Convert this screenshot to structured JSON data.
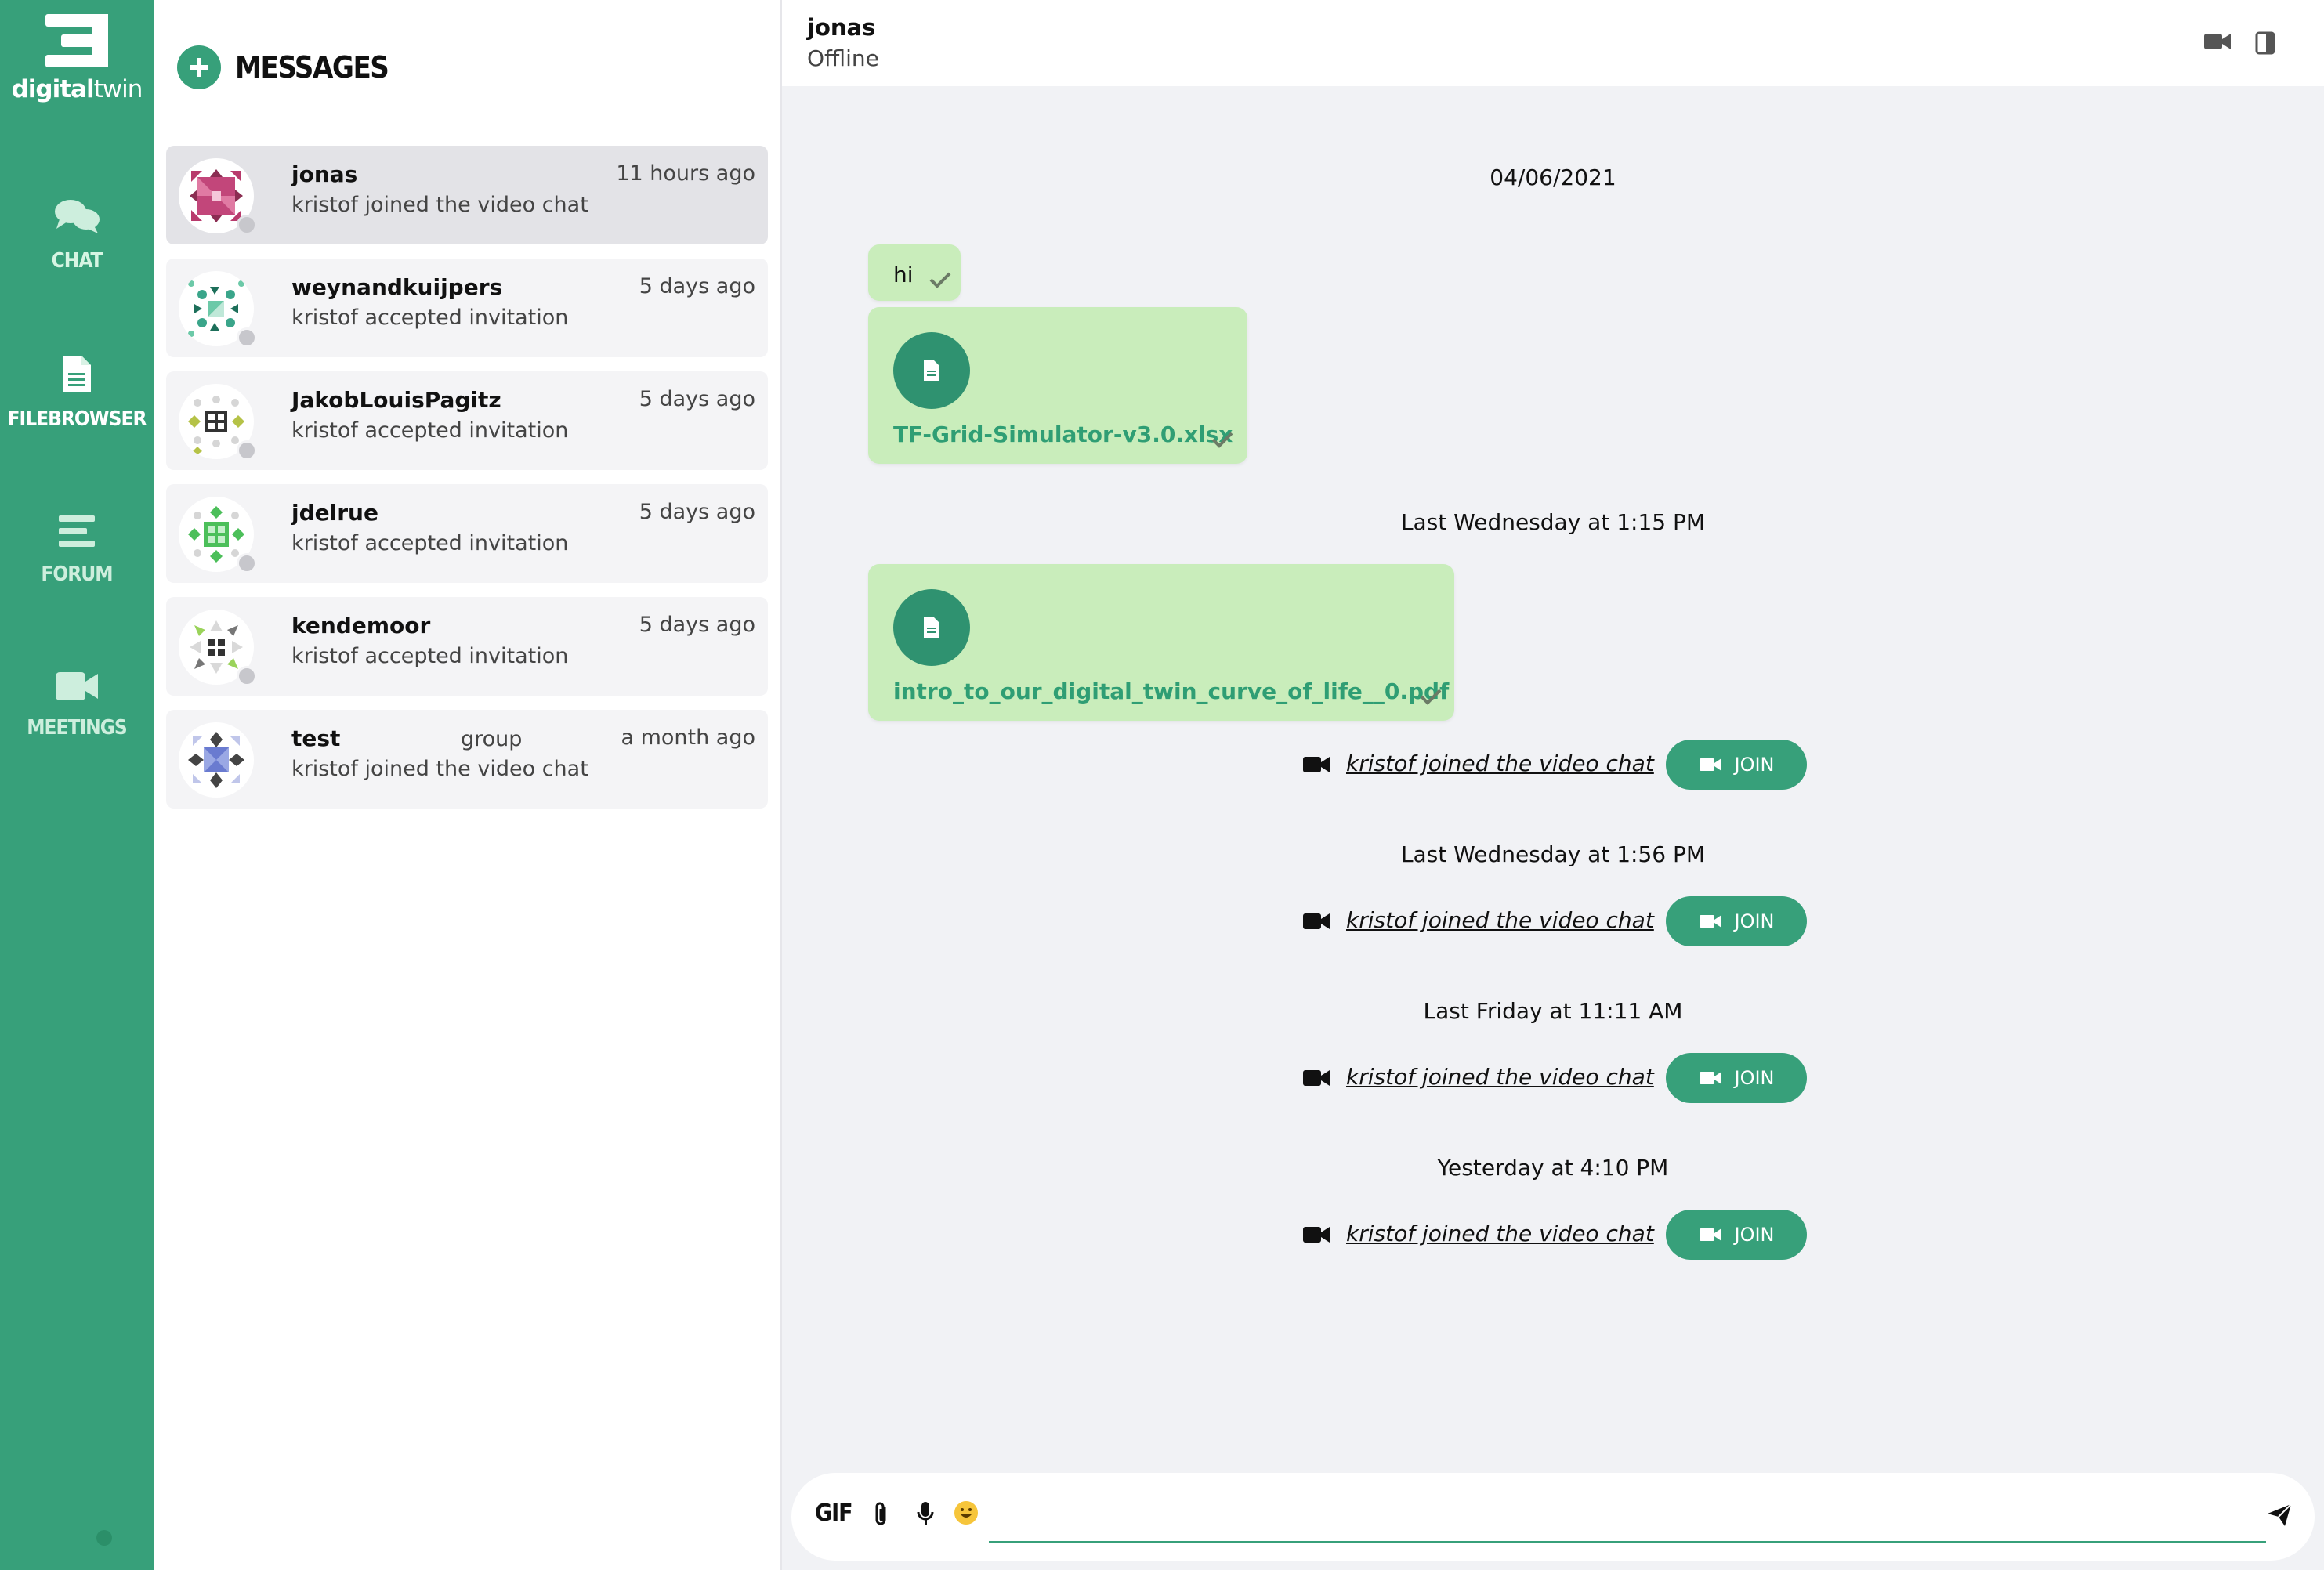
{
  "brand": {
    "logo_bold": "digital",
    "logo_light": "twin"
  },
  "nav": {
    "items": [
      {
        "label": "CHAT",
        "icon": "chat-bubbles-icon"
      },
      {
        "label": "FILEBROWSER",
        "icon": "file-icon"
      },
      {
        "label": "FORUM",
        "icon": "forum-lines-icon"
      },
      {
        "label": "MEETINGS",
        "icon": "video-camera-icon"
      }
    ],
    "accent": "#37a07a"
  },
  "list": {
    "title": "MESSAGES",
    "conversations": [
      {
        "name": "jonas",
        "tag": "",
        "time": "11 hours ago",
        "last": "kristof joined the video chat",
        "selected": true
      },
      {
        "name": "weynandkuijpers",
        "tag": "",
        "time": "5 days ago",
        "last": "kristof accepted invitation"
      },
      {
        "name": "JakobLouisPagitz",
        "tag": "",
        "time": "5 days ago",
        "last": "kristof accepted invitation"
      },
      {
        "name": "jdelrue",
        "tag": "",
        "time": "5 days ago",
        "last": "kristof accepted invitation"
      },
      {
        "name": "kendemoor",
        "tag": "",
        "time": "5 days ago",
        "last": "kristof accepted invitation"
      },
      {
        "name": "test",
        "tag": "group",
        "time": "a month ago",
        "last": "kristof joined the video chat"
      }
    ]
  },
  "chat": {
    "name": "jonas",
    "status": "Offline",
    "separators": [
      "04/06/2021",
      "Last Wednesday at 1:15 PM",
      "Last Wednesday at 1:56 PM",
      "Last Friday at 11:11 AM",
      "Yesterday at 4:10 PM"
    ],
    "text_message": "hi",
    "files": [
      "TF-Grid-Simulator-v3.0.xlsx",
      "intro_to_our_digital_twin_curve_of_life__0.pdf"
    ],
    "system_message": "kristof joined the video chat",
    "join_label": "JOIN"
  },
  "composer": {
    "gif_label": "GIF",
    "value": "",
    "placeholder": ""
  }
}
